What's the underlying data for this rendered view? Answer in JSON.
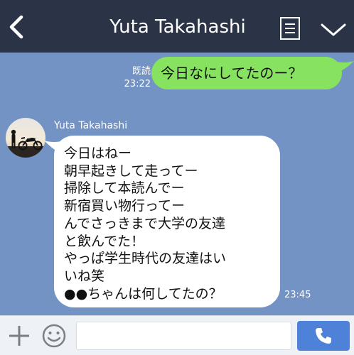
{
  "header": {
    "title": "Yuta Takahashi",
    "icons": [
      "back-arrow-icon",
      "memo-icon",
      "chevron-down-icon"
    ]
  },
  "outgoing": {
    "read_label": "既読",
    "time": "23:22",
    "text": "今日なにしてたのー？",
    "bubble_color": "#86e25f"
  },
  "incoming": {
    "sender": "Yuta Takahashi",
    "lines": [
      "今日はねー",
      "朝早起きして走ってー",
      "掃除して本読んでー",
      "新宿買い物行ってー",
      "んでさっきまで大学の友達",
      "と飲んでた！",
      "やっぱ学生時代の友達はい",
      "いね笑",
      "●●ちゃんは何してたの？"
    ],
    "time": "23:45",
    "bubble_color": "#ffffff"
  },
  "input": {
    "value": "",
    "icons": [
      "plus-icon",
      "smile-icon",
      "phone-icon"
    ]
  },
  "colors": {
    "background": "#7393c4",
    "header": "#2b3447",
    "call_button": "#4d82d8"
  }
}
